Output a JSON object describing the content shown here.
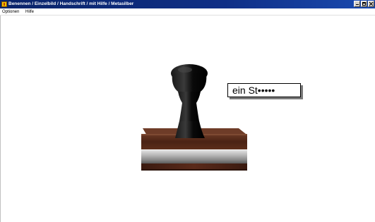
{
  "window": {
    "title": "Benennen / Einzelbild / Handschrift / mit Hilfe / Metasilber"
  },
  "menu": {
    "items": [
      {
        "label": "Optionen"
      },
      {
        "label": "Hilfe"
      }
    ]
  },
  "exercise": {
    "image": "rubber-stamp",
    "word_hint": "ein St•••••"
  },
  "colors": {
    "titlebar": "#0a246a",
    "stamp_wood": "#5a2a1a",
    "stamp_handle": "#111111"
  }
}
